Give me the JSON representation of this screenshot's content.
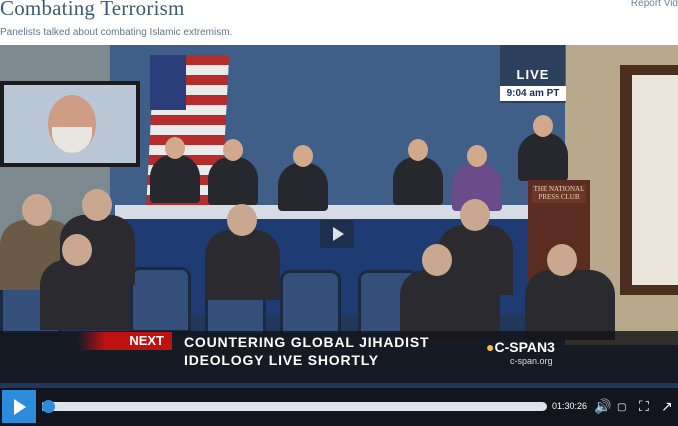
{
  "header": {
    "title": "Combating Terrorism",
    "report_link": "Report Vid",
    "caption": "Panelists talked about combating Islamic extremism."
  },
  "video": {
    "live_label": "LIVE",
    "time_badge": "9:04 am PT",
    "podium_sign": "THE NATIONAL PRESS CLUB",
    "lower_third": {
      "next_label": "NEXT",
      "line1": "COUNTERING GLOBAL JIHADIST",
      "line2": "IDEOLOGY  LIVE SHORTLY",
      "network": "C-SPAN3",
      "network_url": "c-span.org"
    },
    "controls": {
      "time": "01:30:26",
      "progress_fraction": 0.006,
      "icons": [
        "play-icon",
        "volume-icon",
        "closed-captions-icon",
        "fullscreen-icon",
        "popout-icon"
      ]
    }
  },
  "colors": {
    "title": "#3d5a74",
    "play_button": "#2d8bdc",
    "next_tag": "#c01111"
  }
}
